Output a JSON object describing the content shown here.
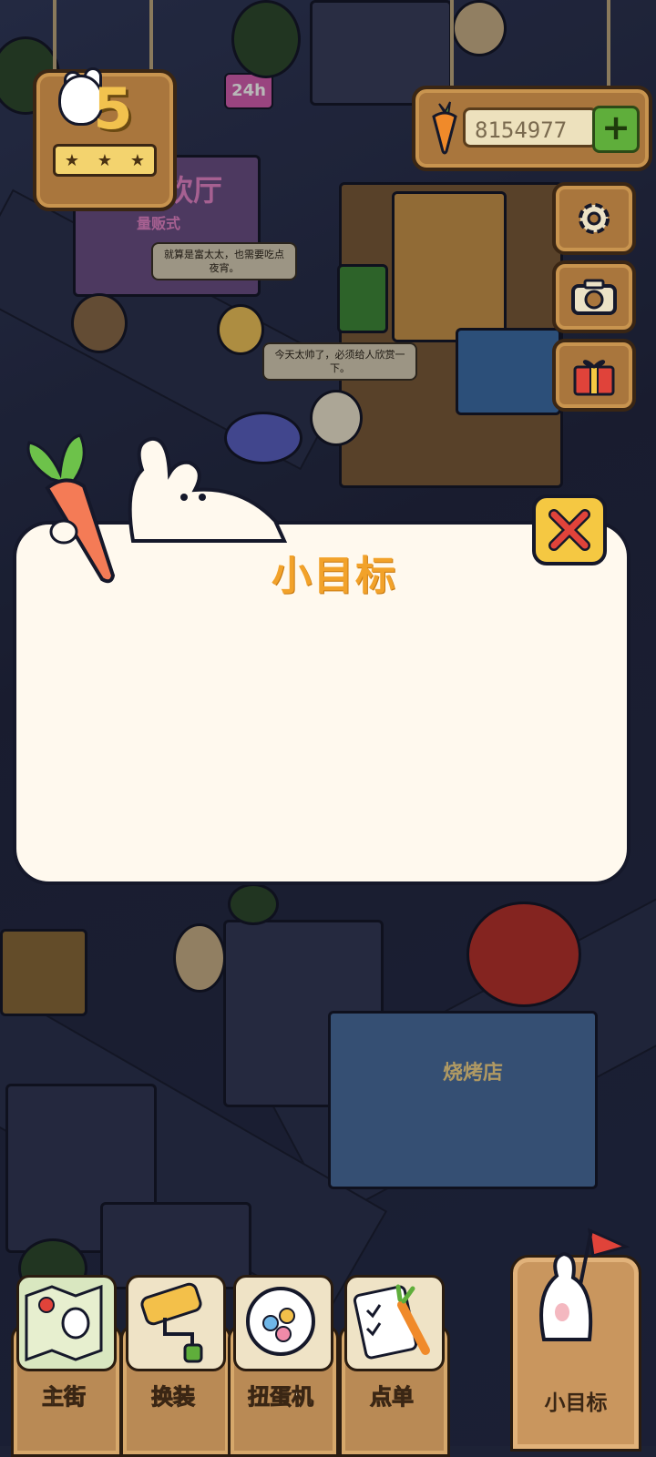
{
  "hud": {
    "level": "5",
    "carrots": "8154977",
    "add_symbol": "+"
  },
  "scene": {
    "sign_24h": "24h",
    "sign_hall": "饮厅",
    "sign_shop": "量贩式",
    "bubble_1": "就算是富太太，也需要吃点夜宵。",
    "bubble_2": "今天太帅了，必须给人欣赏一下。",
    "bbq_sign": "烧烤店"
  },
  "modal": {
    "title": "小目标"
  },
  "nav": {
    "items": [
      {
        "label": "主街",
        "icon": "map-icon"
      },
      {
        "label": "换装",
        "icon": "paint-roller-icon"
      },
      {
        "label": "扭蛋机",
        "icon": "gacha-machine-icon"
      },
      {
        "label": "点单",
        "icon": "order-clipboard-icon"
      }
    ],
    "goal_label": "小目标"
  },
  "colors": {
    "panel_bg": "#fff9ee",
    "title": "#f2a22a",
    "close_bg": "#f5c842",
    "close_x": "#e0433a",
    "wood": "#a9763d"
  }
}
